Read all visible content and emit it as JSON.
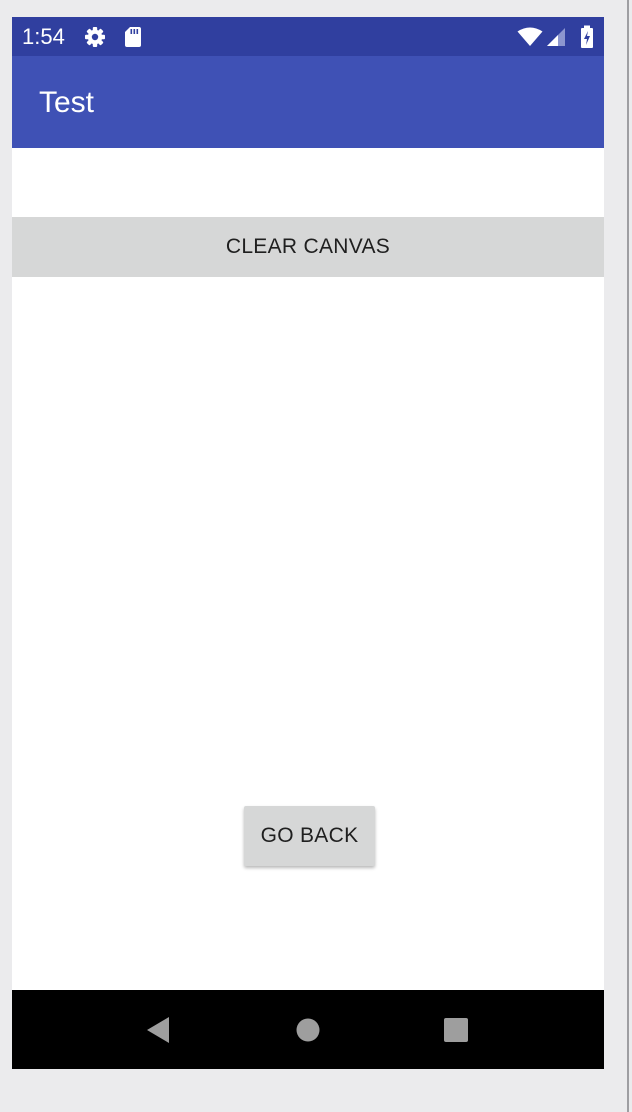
{
  "status_bar": {
    "time": "1:54",
    "background_color": "#303f9f",
    "icons": [
      "settings-icon",
      "sd-card-icon",
      "wifi-icon",
      "cell-signal-icon",
      "battery-charging-icon"
    ]
  },
  "app_bar": {
    "title": "Test",
    "background_color": "#3f51b5"
  },
  "main": {
    "clear_canvas_label": "CLEAR CANVAS",
    "go_back_label": "GO BACK",
    "button_color": "#d6d7d7"
  },
  "nav_bar": {
    "background_color": "#000000",
    "buttons": [
      "back-triangle-icon",
      "home-circle-icon",
      "recents-square-icon"
    ]
  }
}
